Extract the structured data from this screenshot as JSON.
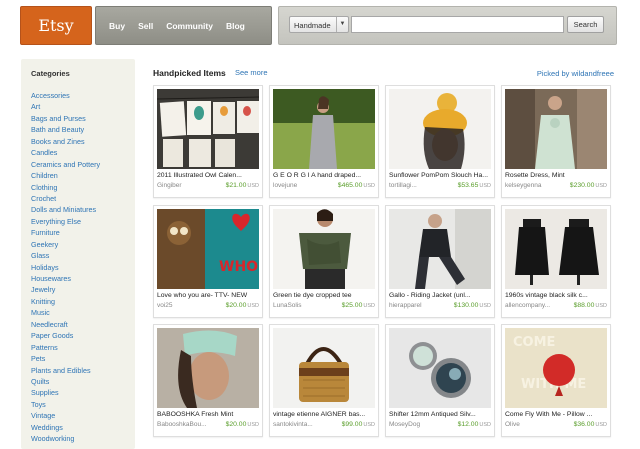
{
  "header": {
    "logo_text": "Etsy",
    "nav": [
      "Buy",
      "Sell",
      "Community",
      "Blog"
    ],
    "search": {
      "category": "Handmade",
      "query": "",
      "button": "Search"
    }
  },
  "sidebar": {
    "title": "Categories",
    "items": [
      "Accessories",
      "Art",
      "Bags and Purses",
      "Bath and Beauty",
      "Books and Zines",
      "Candles",
      "Ceramics and Pottery",
      "Children",
      "Clothing",
      "Crochet",
      "Dolls and Miniatures",
      "Everything Else",
      "Furniture",
      "Geekery",
      "Glass",
      "Holidays",
      "Housewares",
      "Jewelry",
      "Knitting",
      "Music",
      "Needlecraft",
      "Paper Goods",
      "Patterns",
      "Pets",
      "Plants and Edibles",
      "Quilts",
      "Supplies",
      "Toys",
      "Vintage",
      "Weddings",
      "Woodworking"
    ]
  },
  "main": {
    "section_title": "Handpicked Items",
    "see_more": "See more",
    "picked_by": "Picked by wildandfreee",
    "currency": "USD",
    "items": [
      {
        "title": "2011 Illustrated Owl Calen...",
        "shop": "Gingiber",
        "price": "$21.00"
      },
      {
        "title": "G E O R G I A hand draped...",
        "shop": "lovejune",
        "price": "$465.00"
      },
      {
        "title": "Sunflower PomPom Slouch Ha...",
        "shop": "tortillagi...",
        "price": "$53.65"
      },
      {
        "title": "Rosette Dress, Mint",
        "shop": "kelseygenna",
        "price": "$230.00"
      },
      {
        "title": "Love who you are- TTV- NEW",
        "shop": "voi25",
        "price": "$20.00"
      },
      {
        "title": "Green tie dye cropped tee",
        "shop": "LunaSolis",
        "price": "$25.00"
      },
      {
        "title": "Gallo - Riding Jacket (unl...",
        "shop": "hierapparel",
        "price": "$130.00"
      },
      {
        "title": "1960s vintage black silk c...",
        "shop": "allencompany...",
        "price": "$88.00"
      },
      {
        "title": "BABOOSHKA Fresh Mint",
        "shop": "BabooshkaBou...",
        "price": "$20.00"
      },
      {
        "title": "vintage etienne AIGNER bas...",
        "shop": "santokivinta...",
        "price": "$99.00"
      },
      {
        "title": "Shifter 12mm Antiqued Silv...",
        "shop": "MoseyDog",
        "price": "$12.00"
      },
      {
        "title": "Come Fly With Me - Pillow ...",
        "shop": "Olive",
        "price": "$36.00"
      }
    ]
  }
}
